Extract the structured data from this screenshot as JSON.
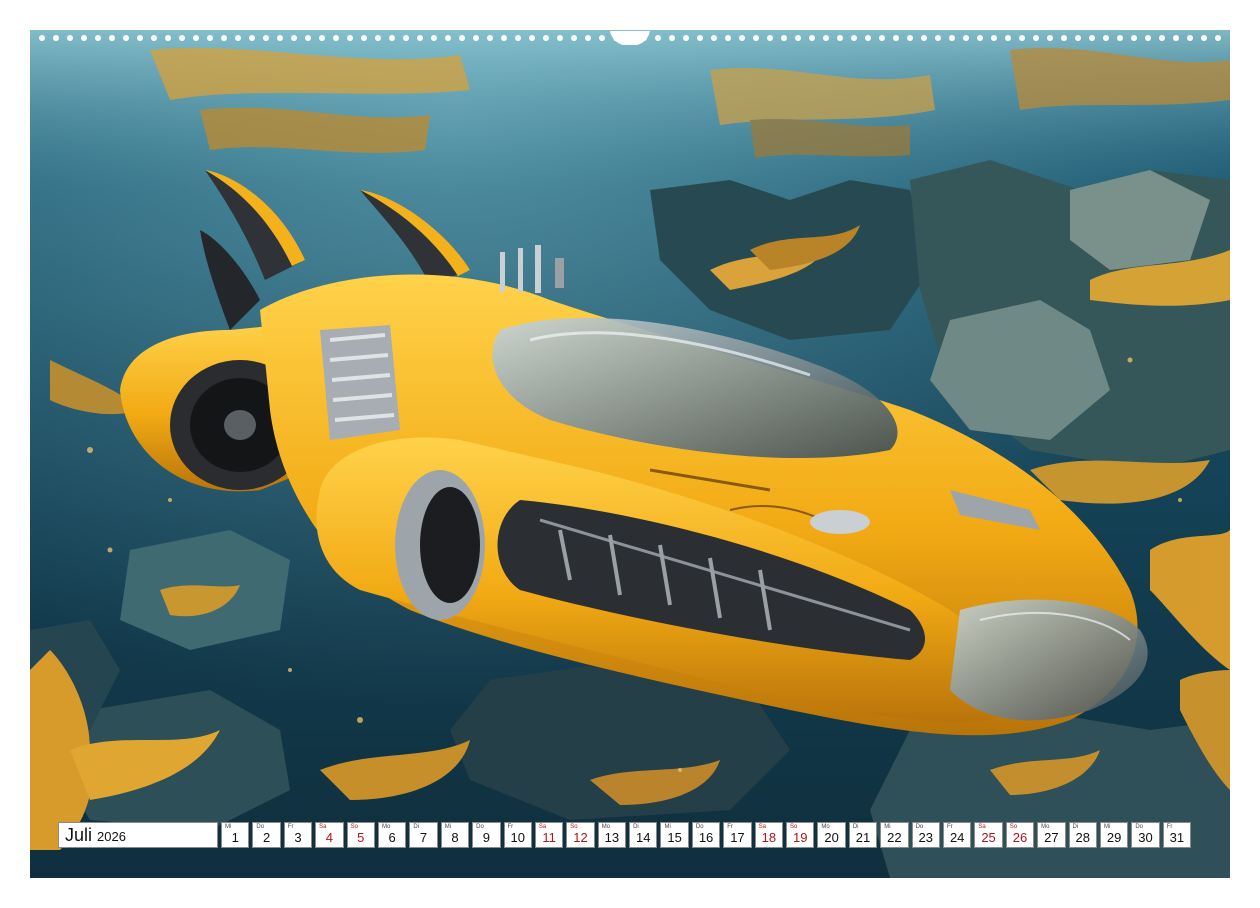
{
  "calendar": {
    "month": "Juli",
    "year": "2026",
    "days": [
      {
        "wd": "Mi",
        "num": "1",
        "weekend": false
      },
      {
        "wd": "Do",
        "num": "2",
        "weekend": false
      },
      {
        "wd": "Fr",
        "num": "3",
        "weekend": false
      },
      {
        "wd": "Sa",
        "num": "4",
        "weekend": true
      },
      {
        "wd": "So",
        "num": "5",
        "weekend": true
      },
      {
        "wd": "Mo",
        "num": "6",
        "weekend": false
      },
      {
        "wd": "Di",
        "num": "7",
        "weekend": false
      },
      {
        "wd": "Mi",
        "num": "8",
        "weekend": false
      },
      {
        "wd": "Do",
        "num": "9",
        "weekend": false
      },
      {
        "wd": "Fr",
        "num": "10",
        "weekend": false
      },
      {
        "wd": "Sa",
        "num": "11",
        "weekend": true
      },
      {
        "wd": "So",
        "num": "12",
        "weekend": true
      },
      {
        "wd": "Mo",
        "num": "13",
        "weekend": false
      },
      {
        "wd": "Di",
        "num": "14",
        "weekend": false
      },
      {
        "wd": "Mi",
        "num": "15",
        "weekend": false
      },
      {
        "wd": "Do",
        "num": "16",
        "weekend": false
      },
      {
        "wd": "Fr",
        "num": "17",
        "weekend": false
      },
      {
        "wd": "Sa",
        "num": "18",
        "weekend": true
      },
      {
        "wd": "So",
        "num": "19",
        "weekend": true
      },
      {
        "wd": "Mo",
        "num": "20",
        "weekend": false
      },
      {
        "wd": "Di",
        "num": "21",
        "weekend": false
      },
      {
        "wd": "Mi",
        "num": "22",
        "weekend": false
      },
      {
        "wd": "Do",
        "num": "23",
        "weekend": false
      },
      {
        "wd": "Fr",
        "num": "24",
        "weekend": false
      },
      {
        "wd": "Sa",
        "num": "25",
        "weekend": true
      },
      {
        "wd": "So",
        "num": "26",
        "weekend": true
      },
      {
        "wd": "Mo",
        "num": "27",
        "weekend": false
      },
      {
        "wd": "Di",
        "num": "28",
        "weekend": false
      },
      {
        "wd": "Mi",
        "num": "29",
        "weekend": false
      },
      {
        "wd": "Do",
        "num": "30",
        "weekend": false
      },
      {
        "wd": "Fr",
        "num": "31",
        "weekend": false
      }
    ]
  },
  "colors": {
    "weekend": "#b0141c",
    "submarine": "#f2b21d",
    "water": "#1e5a72"
  },
  "illustration": {
    "subject_icon": "submarine-icon"
  }
}
